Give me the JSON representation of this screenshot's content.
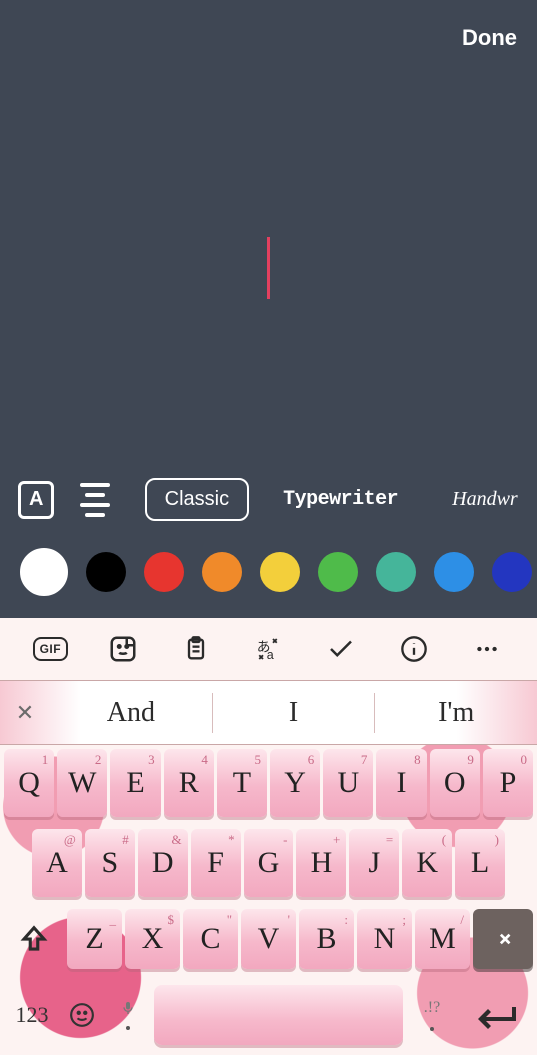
{
  "header": {
    "done": "Done"
  },
  "fonts": [
    {
      "label": "Classic",
      "active": true,
      "style": "classic"
    },
    {
      "label": "Typewriter",
      "active": false,
      "style": "typewriter"
    },
    {
      "label": "Handwr",
      "active": false,
      "style": "handwriting"
    }
  ],
  "colors": [
    {
      "hex": "#ffffff",
      "selected": true
    },
    {
      "hex": "#000000",
      "selected": false
    },
    {
      "hex": "#e7352f",
      "selected": false
    },
    {
      "hex": "#f08a2a",
      "selected": false
    },
    {
      "hex": "#f3cf3b",
      "selected": false
    },
    {
      "hex": "#4fbb4a",
      "selected": false
    },
    {
      "hex": "#45b59a",
      "selected": false
    },
    {
      "hex": "#2d8fe6",
      "selected": false
    },
    {
      "hex": "#2336c0",
      "selected": false
    }
  ],
  "kb_toolbar": [
    "gif",
    "sticker",
    "clipboard",
    "translate",
    "format",
    "info",
    "more"
  ],
  "suggestions": {
    "items": [
      "And",
      "I",
      "I'm"
    ]
  },
  "rows": {
    "r1": [
      {
        "m": "Q",
        "s": "1"
      },
      {
        "m": "W",
        "s": "2"
      },
      {
        "m": "E",
        "s": "3"
      },
      {
        "m": "R",
        "s": "4"
      },
      {
        "m": "T",
        "s": "5"
      },
      {
        "m": "Y",
        "s": "6"
      },
      {
        "m": "U",
        "s": "7"
      },
      {
        "m": "I",
        "s": "8"
      },
      {
        "m": "O",
        "s": "9"
      },
      {
        "m": "P",
        "s": "0"
      }
    ],
    "r2": [
      {
        "m": "A",
        "s": "@"
      },
      {
        "m": "S",
        "s": "#"
      },
      {
        "m": "D",
        "s": "&"
      },
      {
        "m": "F",
        "s": "*"
      },
      {
        "m": "G",
        "s": "-"
      },
      {
        "m": "H",
        "s": "+"
      },
      {
        "m": "J",
        "s": "="
      },
      {
        "m": "K",
        "s": "("
      },
      {
        "m": "L",
        "s": ")"
      }
    ],
    "r3": [
      {
        "m": "Z",
        "s": "_"
      },
      {
        "m": "X",
        "s": "$"
      },
      {
        "m": "C",
        "s": "\""
      },
      {
        "m": "V",
        "s": "'"
      },
      {
        "m": "B",
        "s": ":"
      },
      {
        "m": "N",
        "s": ";"
      },
      {
        "m": "M",
        "s": "/"
      }
    ]
  },
  "bottom": {
    "numeric": "123",
    "punct": ".!?"
  },
  "text_mode_glyph": "A"
}
